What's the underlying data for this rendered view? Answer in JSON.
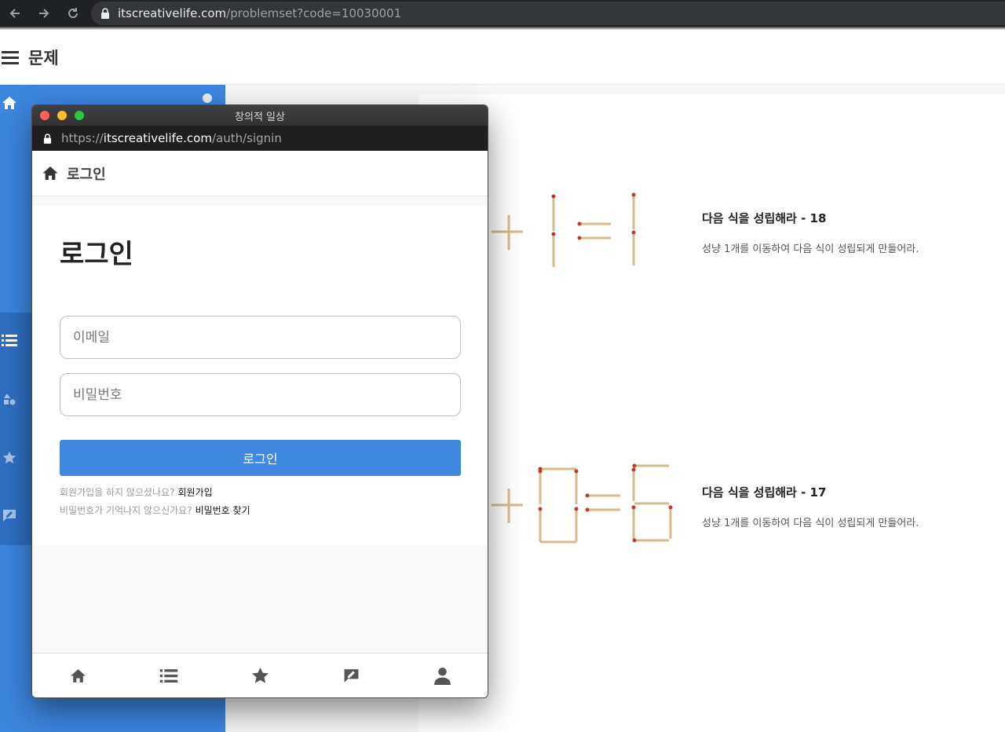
{
  "browser": {
    "url_host": "itscreativelife.com",
    "url_path": "/problemset?code=10030001"
  },
  "page": {
    "header_title": "문제"
  },
  "problems": [
    {
      "title": "다음 식을 성립해라 - 18",
      "description": "성냥 1개를 이동하여 다음 식이 성립되게 만들어라."
    },
    {
      "title": "다음 식을 성립해라 - 17",
      "description": "성냥 1개를 이동하여 다음 식이 성립되게 만들어라."
    }
  ],
  "popup": {
    "window_title": "창의적 일상",
    "url_scheme": "https://",
    "url_host": "itscreativelife.com",
    "url_path": "/auth/signin",
    "header_title": "로그인",
    "login_title": "로그인",
    "email_placeholder": "이메일",
    "password_placeholder": "비밀번호",
    "login_button": "로그인",
    "signup_prompt": "회원가입을 하지 않으셨나요?",
    "signup_link": "회원가입",
    "forgot_prompt": "비밀번호가 기억나지 않으신가요?",
    "forgot_link": "비밀번호 찾기"
  },
  "colors": {
    "primary": "#4189e0",
    "sidebar": "#3d86e0",
    "match_stick": "#d8b98a",
    "match_head": "#c23a2a"
  },
  "icons": {
    "sidebar": [
      "home-icon",
      "list-icon",
      "shapes-icon",
      "star-icon",
      "feedback-icon"
    ],
    "bottom_nav": [
      "home-icon",
      "list-icon",
      "star-icon",
      "feedback-icon",
      "user-icon"
    ]
  }
}
